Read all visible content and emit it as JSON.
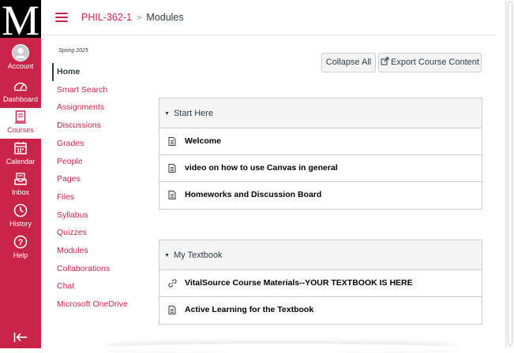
{
  "global_nav": {
    "logo_text": "M",
    "items": [
      {
        "label": "Account",
        "icon": "avatar-icon"
      },
      {
        "label": "Dashboard",
        "icon": "dashboard-icon"
      },
      {
        "label": "Courses",
        "icon": "courses-icon"
      },
      {
        "label": "Calendar",
        "icon": "calendar-icon"
      },
      {
        "label": "Inbox",
        "icon": "inbox-icon"
      },
      {
        "label": "History",
        "icon": "history-icon"
      },
      {
        "label": "Help",
        "icon": "help-icon"
      }
    ],
    "active": "Courses",
    "colors": {
      "brand": "#c8244a",
      "logo_bg": "#000000"
    }
  },
  "breadcrumb": {
    "course": "PHIL-362-1",
    "separator": ">",
    "page": "Modules"
  },
  "course_nav": {
    "term": "Spring 2025",
    "items": [
      "Home",
      "Smart Search",
      "Assignments",
      "Discussions",
      "Grades",
      "People",
      "Pages",
      "Files",
      "Syllabus",
      "Quizzes",
      "Modules",
      "Collaborations",
      "Chat",
      "Microsoft OneDrive"
    ],
    "active": "Home"
  },
  "toolbar": {
    "collapse_all": "Collapse All",
    "export": "Export Course Content"
  },
  "modules": [
    {
      "title": "Start Here",
      "items": [
        {
          "label": "Welcome",
          "icon": "page-icon"
        },
        {
          "label": "video on how to use Canvas in general",
          "icon": "page-icon"
        },
        {
          "label": "Homeworks and Discussion Board",
          "icon": "page-icon"
        }
      ]
    },
    {
      "title": "My Textbook",
      "items": [
        {
          "label": "VitalSource Course Materials--YOUR TEXTBOOK IS HERE",
          "icon": "link-icon"
        },
        {
          "label": "Active Learning for the Textbook",
          "icon": "page-icon"
        }
      ]
    }
  ]
}
